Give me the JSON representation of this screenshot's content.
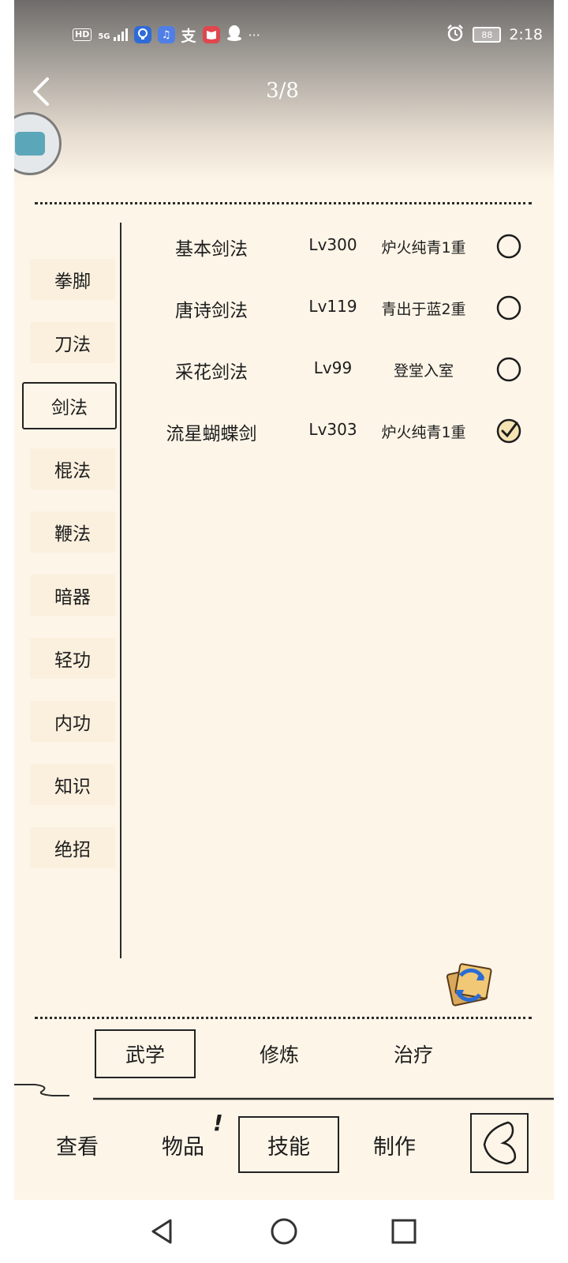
{
  "status_bar": {
    "hd_label": "HD",
    "network_label": "5G",
    "alipay_glyph": "支",
    "more_glyph": "···",
    "battery_level": "88",
    "time": "2:18"
  },
  "header": {
    "page_indicator": "3/8"
  },
  "categories": [
    {
      "label": "拳脚",
      "active": false
    },
    {
      "label": "刀法",
      "active": false
    },
    {
      "label": "剑法",
      "active": true
    },
    {
      "label": "棍法",
      "active": false
    },
    {
      "label": "鞭法",
      "active": false
    },
    {
      "label": "暗器",
      "active": false
    },
    {
      "label": "轻功",
      "active": false
    },
    {
      "label": "内功",
      "active": false
    },
    {
      "label": "知识",
      "active": false
    },
    {
      "label": "绝招",
      "active": false
    }
  ],
  "skills": [
    {
      "name": "基本剑法",
      "level": "Lv300",
      "stage": "炉火纯青1重",
      "equipped": false
    },
    {
      "name": "唐诗剑法",
      "level": "Lv119",
      "stage": "青出于蓝2重",
      "equipped": false
    },
    {
      "name": "采花剑法",
      "level": "Lv99",
      "stage": "登堂入室",
      "equipped": false
    },
    {
      "name": "流星蝴蝶剑",
      "level": "Lv303",
      "stage": "炉火纯青1重",
      "equipped": true
    }
  ],
  "sub_tabs": [
    {
      "label": "武学",
      "active": true
    },
    {
      "label": "修炼",
      "active": false
    },
    {
      "label": "治疗",
      "active": false
    }
  ],
  "bottom_nav": [
    {
      "label": "查看",
      "active": false
    },
    {
      "label": "物品",
      "active": false
    },
    {
      "label": "技能",
      "active": true
    },
    {
      "label": "制作",
      "active": false
    }
  ],
  "item_alert": "!",
  "icons": {
    "back": "chevron-left-icon",
    "avatar": "avatar-icon",
    "sort": "sort-swap-icon",
    "close": "heart-back-icon"
  },
  "colors": {
    "background": "#fdf5e8",
    "ink": "#1d1d1d",
    "sidebar_item": "#fbf0de"
  }
}
